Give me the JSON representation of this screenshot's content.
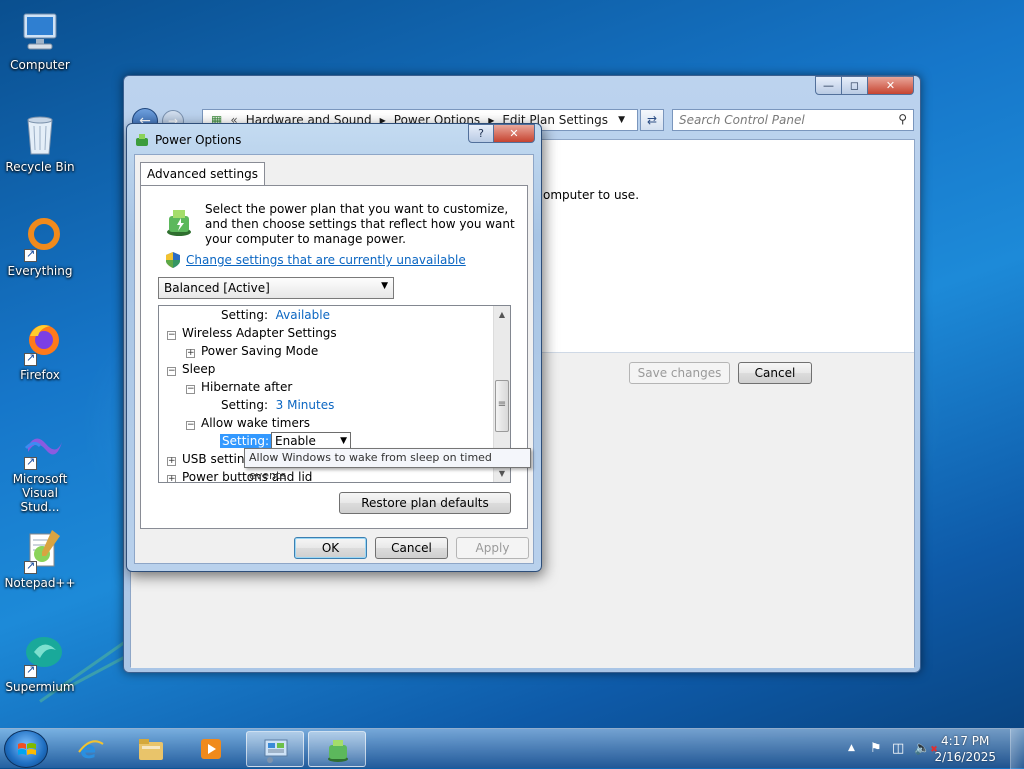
{
  "desktop": {
    "icons": [
      {
        "label": "Computer"
      },
      {
        "label": "Recycle Bin"
      },
      {
        "label": "Everything"
      },
      {
        "label": "Firefox"
      },
      {
        "label": "Microsoft Visual Stud..."
      },
      {
        "label": "Notepad++"
      },
      {
        "label": "Supermium"
      }
    ]
  },
  "explorer": {
    "breadcrumb": [
      "Hardware and Sound",
      "Power Options",
      "Edit Plan Settings"
    ],
    "search_placeholder": "Search Control Panel",
    "body_text": "omputer to use.",
    "save_label": "Save changes",
    "cancel_label": "Cancel"
  },
  "dialog": {
    "title": "Power Options",
    "tab_label": "Advanced settings",
    "intro": "Select the power plan that you want to customize, and then choose settings that reflect how you want your computer to manage power.",
    "change_link": "Change settings that are currently unavailable",
    "plan_selected": "Balanced [Active]",
    "tree": {
      "row1_label": "Setting:",
      "row1_value": "Available",
      "wireless": "Wireless Adapter Settings",
      "power_saving": "Power Saving Mode",
      "sleep": "Sleep",
      "hibernate": "Hibernate after",
      "hibernate_setting_label": "Setting:",
      "hibernate_value": "3 Minutes",
      "wake_timers": "Allow wake timers",
      "wake_setting_label": "Setting:",
      "wake_value": "Enable",
      "usb": "USB settings",
      "power_buttons": "Power buttons and lid"
    },
    "tooltip": "Allow Windows to wake from sleep on timed events.",
    "restore_label": "Restore plan defaults",
    "ok_label": "OK",
    "cancel_label": "Cancel",
    "apply_label": "Apply"
  },
  "taskbar": {
    "time": "4:17 PM",
    "date": "2/16/2025"
  }
}
